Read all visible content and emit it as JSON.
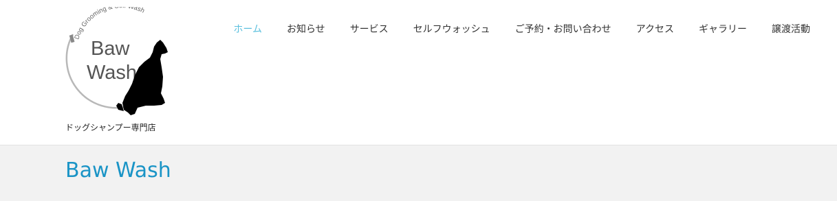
{
  "logo": {
    "arc_text": "Dog Grooming & Self Wash",
    "line1": "Baw",
    "line2": "Wash",
    "icon": "dog-silhouette-icon"
  },
  "tagline": "ドッグシャンプー専門店",
  "nav": {
    "items": [
      {
        "label": "ホーム",
        "active": true
      },
      {
        "label": "お知らせ",
        "active": false
      },
      {
        "label": "サービス",
        "active": false
      },
      {
        "label": "セルフウォッシュ",
        "active": false
      },
      {
        "label": "ご予約・お問い合わせ",
        "active": false
      },
      {
        "label": "アクセス",
        "active": false
      },
      {
        "label": "ギャラリー",
        "active": false
      },
      {
        "label": "譲渡活動",
        "active": false
      }
    ],
    "active_color": "#5bc0de",
    "text_color": "#333333"
  },
  "site_title": "Baw Wash",
  "colors": {
    "title": "#1a94c6",
    "band": "#f2f2f2"
  }
}
